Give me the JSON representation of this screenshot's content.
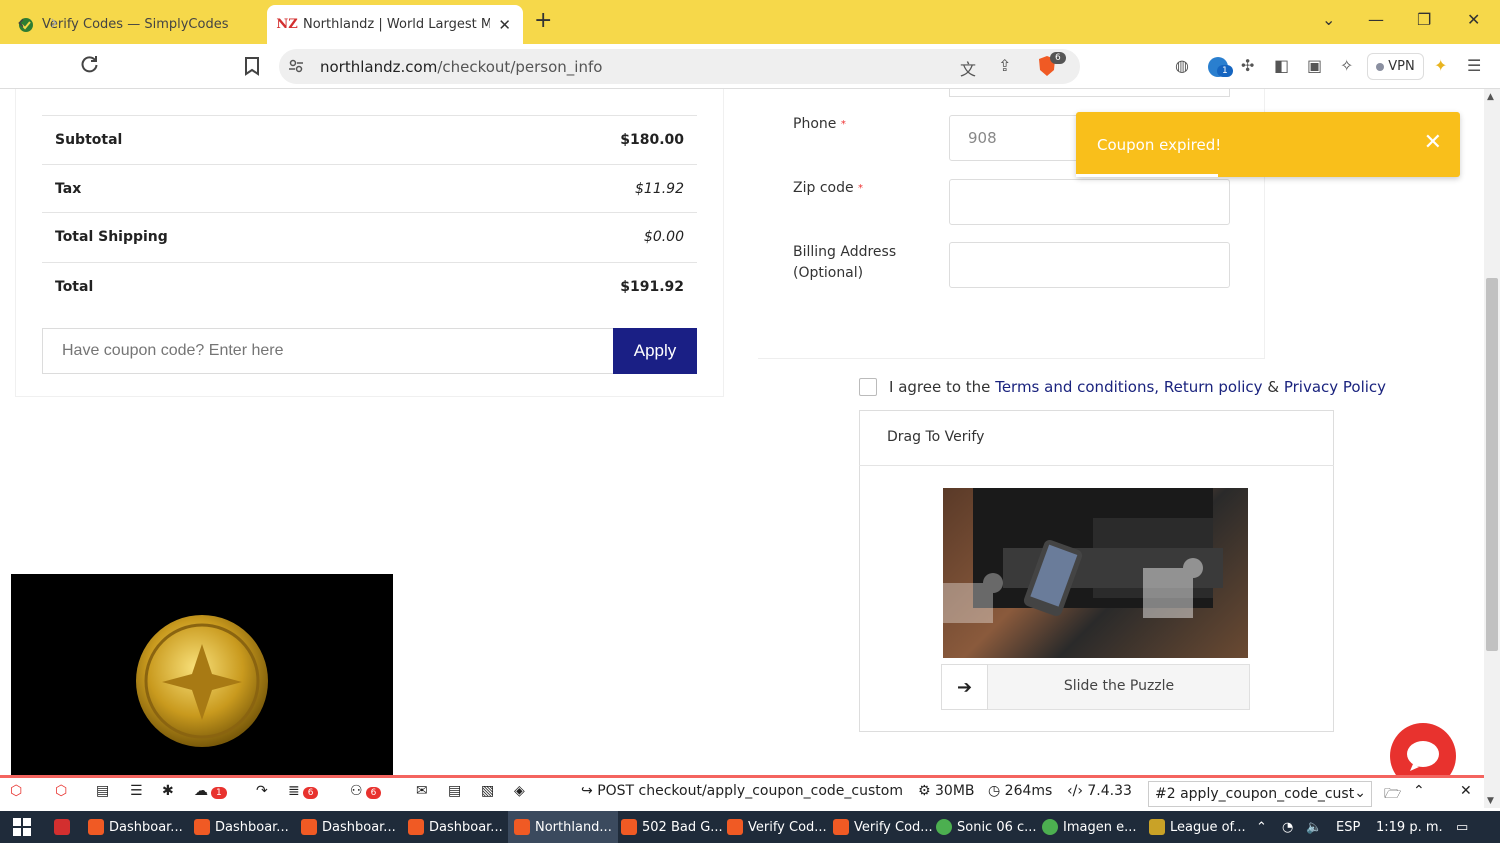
{
  "browser": {
    "tabs": [
      {
        "title": "Verify Codes — SimplyCodes",
        "active": false
      },
      {
        "title": "Northlandz | World Largest Min",
        "active": true
      }
    ],
    "url_host": "northlandz.com",
    "url_path": "/checkout/person_info",
    "brave_badge": "6",
    "ext_badge": "1",
    "vpn_label": "VPN"
  },
  "summary": {
    "rows": [
      {
        "label": "Subtotal",
        "value": "$180.00"
      },
      {
        "label": "Tax",
        "value": "$11.92"
      },
      {
        "label": "Total Shipping",
        "value": "$0.00"
      },
      {
        "label": "Total",
        "value": "$191.92"
      }
    ],
    "coupon_placeholder": "Have coupon code? Enter here",
    "apply_label": "Apply"
  },
  "form": {
    "phone_label": "Phone",
    "phone_value": "908",
    "zip_label": "Zip code",
    "billing_label_1": "Billing Address",
    "billing_label_2": "(Optional)",
    "required_mark": "*"
  },
  "toast": {
    "message": "Coupon expired!"
  },
  "agree": {
    "prefix": "I agree to the",
    "terms": "Terms and conditions,",
    "return": "Return policy",
    "amp": "&",
    "privacy": "Privacy Policy"
  },
  "verify": {
    "title": "Drag To Verify",
    "slider_text": "Slide the Puzzle"
  },
  "debugbar": {
    "badge_1": "1",
    "badge_2": "6",
    "badge_3": "6",
    "request": "POST checkout/apply_coupon_code_custom",
    "memory": "30MB",
    "time": "264ms",
    "version": "7.4.33",
    "select": "#2 apply_coupon_code_cust"
  },
  "taskbar": {
    "items": [
      "Dashboar...",
      "Dashboar...",
      "Dashboar...",
      "Dashboar...",
      "Northland...",
      "502 Bad G...",
      "Verify Cod...",
      "Verify Cod...",
      "Sonic 06 c...",
      "Imagen e...",
      "League of..."
    ],
    "lang": "ESP",
    "time": "1:19 p. m."
  }
}
